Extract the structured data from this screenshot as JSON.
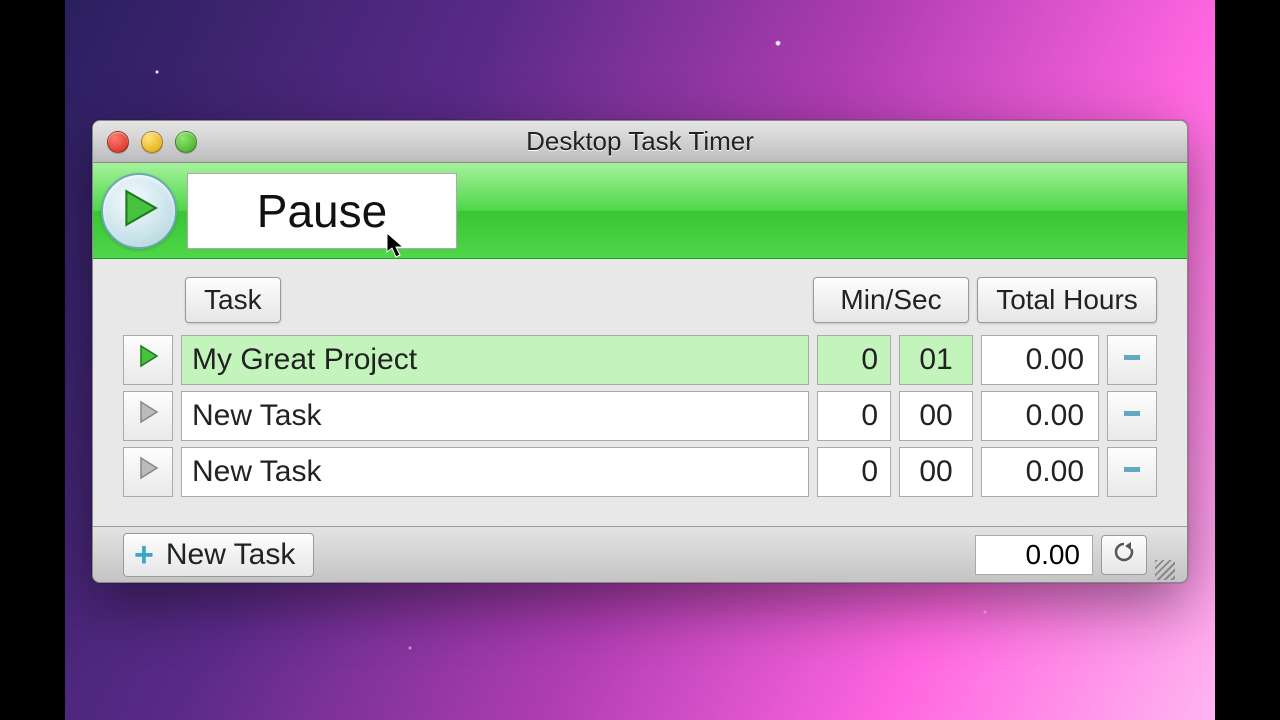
{
  "window": {
    "title": "Desktop Task Timer"
  },
  "toolbar": {
    "pause_label": "Pause"
  },
  "headers": {
    "task": "Task",
    "minsec": "Min/Sec",
    "total": "Total Hours"
  },
  "tasks": [
    {
      "name": "My Great Project",
      "min": "0",
      "sec": "01",
      "hours": "0.00",
      "active": true
    },
    {
      "name": "New Task",
      "min": "0",
      "sec": "00",
      "hours": "0.00",
      "active": false
    },
    {
      "name": "New Task",
      "min": "0",
      "sec": "00",
      "hours": "0.00",
      "active": false
    }
  ],
  "footer": {
    "new_task_label": "New Task",
    "grand_total": "0.00"
  }
}
